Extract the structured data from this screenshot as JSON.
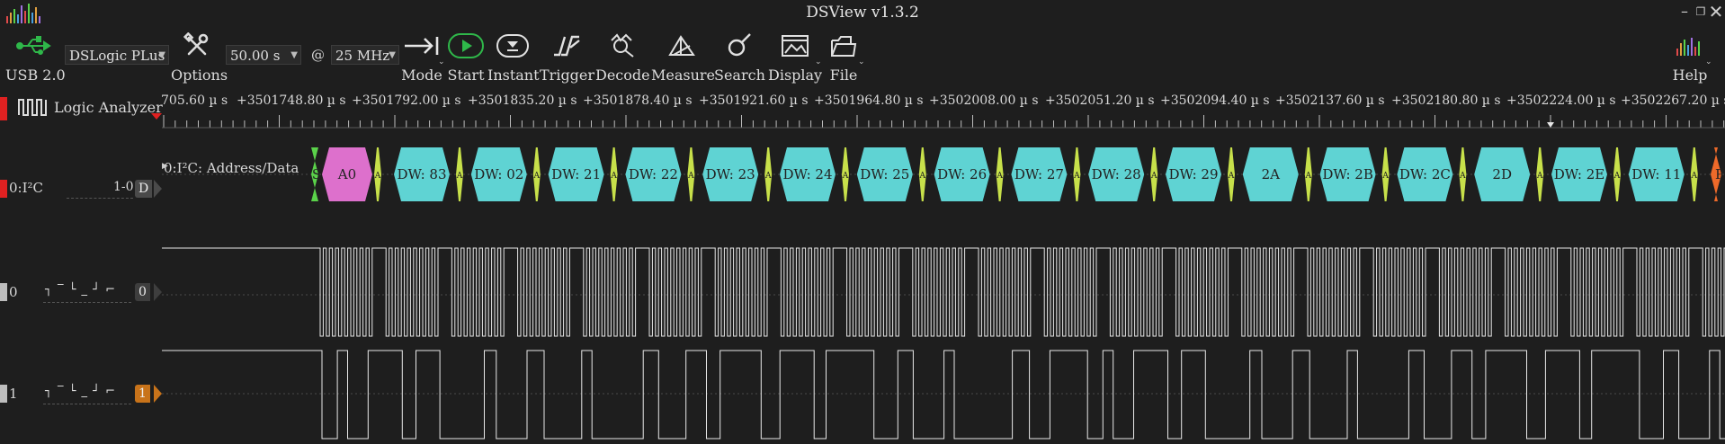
{
  "window": {
    "title": "DSView v1.3.2",
    "buttons": [
      "minimize",
      "restore",
      "close"
    ]
  },
  "toolbar": {
    "usb": "USB 2.0",
    "device": "DSLogic PLus",
    "options": "Options",
    "duration": "50.00 s",
    "at": "@",
    "rate": "25 MHz",
    "mode": "Mode",
    "start": "Start",
    "instant": "Instant",
    "trigger": "Trigger",
    "decode": "Decode",
    "measure": "Measure",
    "search": "Search",
    "display": "Display",
    "file": "File",
    "help": "Help"
  },
  "ruler": {
    "labels": [
      "705.60 µ s",
      "+3501748.80 µ s",
      "+3501792.00 µ s",
      "+3501835.20 µ s",
      "+3501878.40 µ s",
      "+3501921.60 µ s",
      "+3501964.80 µ s",
      "+3502008.00 µ s",
      "+3502051.20 µ s",
      "+3502094.40 µ s",
      "+3502137.60 µ s",
      "+3502180.80 µ s",
      "+3502224.00 µ s",
      "+3502267.20 µ s"
    ]
  },
  "sidebar": {
    "analyzer_title": "Logic Analyzer",
    "decoder_name": "0:I²C",
    "decoder_range": "1-0",
    "decoder_chip": "D",
    "ch0_label": "0",
    "ch0_chip": "0",
    "ch1_label": "1",
    "ch1_chip": "1",
    "edge_glyph": "┐ ‾ └ _ ┘ ⌐"
  },
  "decoder": {
    "annotation_row": "0:I²C: Address/Data",
    "segments": [
      "S",
      "A0",
      "DW: 83",
      "DW: 02",
      "DW: 21",
      "DW: 22",
      "DW: 23",
      "DW: 24",
      "DW: 25",
      "DW: 26",
      "DW: 27",
      "DW: 28",
      "DW: 29",
      "2A",
      "DW: 2B",
      "DW: 2C",
      "2D",
      "DW: 2E",
      "DW: 11",
      "P"
    ],
    "small_marks": [
      "A",
      "A",
      "A",
      "A",
      "A",
      "A",
      "A",
      "A",
      "A",
      "A",
      "A",
      "A",
      "A",
      "A",
      "A",
      "A",
      "A"
    ]
  },
  "colors": {
    "address": "#dd70cc",
    "data": "#5fd3d3",
    "ack": "#c7e04a",
    "start": "#5ad24a",
    "stop": "#ee6a2a",
    "ch_decoder": "#e02121",
    "ch1_chip": "#c8731a"
  }
}
